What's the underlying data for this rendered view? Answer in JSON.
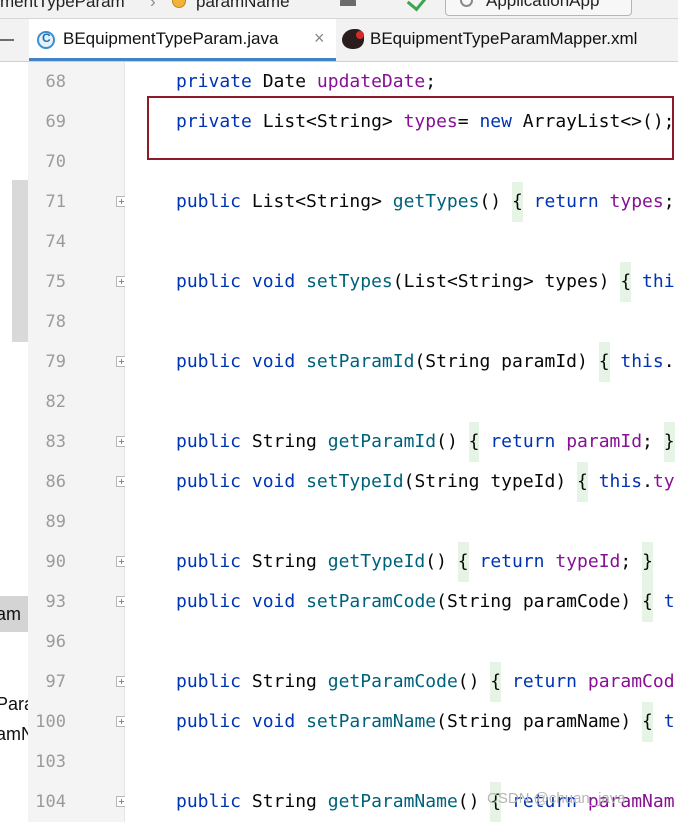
{
  "topbar": {
    "crumb_left": "mentTypeParam",
    "crumb_right": "paramName",
    "sep": "›",
    "run_config": "ApplicationApp"
  },
  "tabs": [
    {
      "label": "BEquipmentTypeParam.java",
      "close": "×",
      "icon": "java-class-icon"
    },
    {
      "label": "BEquipmentTypeParamMapper.xml",
      "icon": "mybatis-bird-icon"
    }
  ],
  "left_panel": {
    "fragments": [
      "am",
      "Para",
      "amN"
    ]
  },
  "editor": {
    "lines": [
      {
        "num": "68",
        "fold": false,
        "parts": [
          [
            "kw",
            "private"
          ],
          [
            "t",
            " Date "
          ],
          [
            "fld",
            "updateDate"
          ],
          [
            "t",
            ";"
          ]
        ]
      },
      {
        "num": "69",
        "fold": false,
        "parts": [
          [
            "kw",
            "private"
          ],
          [
            "t",
            " List<String> "
          ],
          [
            "fld",
            "types"
          ],
          [
            "t",
            "= "
          ],
          [
            "kw",
            "new"
          ],
          [
            "t",
            " ArrayList<>();"
          ]
        ]
      },
      {
        "num": "70",
        "fold": false,
        "parts": []
      },
      {
        "num": "71",
        "fold": true,
        "parts": [
          [
            "kw",
            "public"
          ],
          [
            "t",
            " List<String> "
          ],
          [
            "fn",
            "getTypes"
          ],
          [
            "t",
            "() "
          ],
          [
            "br",
            "{"
          ],
          [
            "t",
            " "
          ],
          [
            "kw",
            "return"
          ],
          [
            "t",
            " "
          ],
          [
            "fld",
            "types"
          ],
          [
            "t",
            ";"
          ]
        ]
      },
      {
        "num": "74",
        "fold": false,
        "parts": []
      },
      {
        "num": "75",
        "fold": true,
        "parts": [
          [
            "kw",
            "public"
          ],
          [
            "t",
            " "
          ],
          [
            "kw",
            "void"
          ],
          [
            "t",
            " "
          ],
          [
            "fn",
            "setTypes"
          ],
          [
            "t",
            "(List<String> types) "
          ],
          [
            "br",
            "{"
          ],
          [
            "t",
            " "
          ],
          [
            "kw",
            "thi"
          ]
        ]
      },
      {
        "num": "78",
        "fold": false,
        "parts": []
      },
      {
        "num": "79",
        "fold": true,
        "parts": [
          [
            "kw",
            "public"
          ],
          [
            "t",
            " "
          ],
          [
            "kw",
            "void"
          ],
          [
            "t",
            " "
          ],
          [
            "fn",
            "setParamId"
          ],
          [
            "t",
            "(String paramId) "
          ],
          [
            "br",
            "{"
          ],
          [
            "t",
            " "
          ],
          [
            "kw",
            "this"
          ],
          [
            "t",
            "."
          ]
        ]
      },
      {
        "num": "82",
        "fold": false,
        "parts": []
      },
      {
        "num": "83",
        "fold": true,
        "parts": [
          [
            "kw",
            "public"
          ],
          [
            "t",
            " String "
          ],
          [
            "fn",
            "getParamId"
          ],
          [
            "t",
            "() "
          ],
          [
            "br",
            "{"
          ],
          [
            "t",
            " "
          ],
          [
            "kw",
            "return"
          ],
          [
            "t",
            " "
          ],
          [
            "fld",
            "paramId"
          ],
          [
            "t",
            "; "
          ],
          [
            "br",
            "}"
          ]
        ]
      },
      {
        "num": "86",
        "fold": true,
        "parts": [
          [
            "kw",
            "public"
          ],
          [
            "t",
            " "
          ],
          [
            "kw",
            "void"
          ],
          [
            "t",
            " "
          ],
          [
            "fn",
            "setTypeId"
          ],
          [
            "t",
            "(String typeId) "
          ],
          [
            "br",
            "{"
          ],
          [
            "t",
            " "
          ],
          [
            "kw",
            "this"
          ],
          [
            "t",
            "."
          ],
          [
            "fld",
            "ty"
          ]
        ]
      },
      {
        "num": "89",
        "fold": false,
        "parts": []
      },
      {
        "num": "90",
        "fold": true,
        "parts": [
          [
            "kw",
            "public"
          ],
          [
            "t",
            " String "
          ],
          [
            "fn",
            "getTypeId"
          ],
          [
            "t",
            "() "
          ],
          [
            "br",
            "{"
          ],
          [
            "t",
            " "
          ],
          [
            "kw",
            "return"
          ],
          [
            "t",
            " "
          ],
          [
            "fld",
            "typeId"
          ],
          [
            "t",
            "; "
          ],
          [
            "br",
            "}"
          ]
        ]
      },
      {
        "num": "93",
        "fold": true,
        "parts": [
          [
            "kw",
            "public"
          ],
          [
            "t",
            " "
          ],
          [
            "kw",
            "void"
          ],
          [
            "t",
            " "
          ],
          [
            "fn",
            "setParamCode"
          ],
          [
            "t",
            "(String paramCode) "
          ],
          [
            "br",
            "{"
          ],
          [
            "t",
            " "
          ],
          [
            "kw",
            "t"
          ]
        ]
      },
      {
        "num": "96",
        "fold": false,
        "parts": []
      },
      {
        "num": "97",
        "fold": true,
        "parts": [
          [
            "kw",
            "public"
          ],
          [
            "t",
            " String "
          ],
          [
            "fn",
            "getParamCode"
          ],
          [
            "t",
            "() "
          ],
          [
            "br",
            "{"
          ],
          [
            "t",
            " "
          ],
          [
            "kw",
            "return"
          ],
          [
            "t",
            " "
          ],
          [
            "fld",
            "paramCod"
          ]
        ]
      },
      {
        "num": "100",
        "fold": true,
        "parts": [
          [
            "kw",
            "public"
          ],
          [
            "t",
            " "
          ],
          [
            "kw",
            "void"
          ],
          [
            "t",
            " "
          ],
          [
            "fn",
            "setParamName"
          ],
          [
            "t",
            "(String paramName) "
          ],
          [
            "br",
            "{"
          ],
          [
            "t",
            " "
          ],
          [
            "kw",
            "t"
          ]
        ]
      },
      {
        "num": "103",
        "fold": false,
        "parts": []
      },
      {
        "num": "104",
        "fold": true,
        "parts": [
          [
            "kw",
            "public"
          ],
          [
            "t",
            " String "
          ],
          [
            "fn",
            "getParamName"
          ],
          [
            "t",
            "() "
          ],
          [
            "br",
            "{"
          ],
          [
            "t",
            " "
          ],
          [
            "kw",
            "return"
          ],
          [
            "t",
            " "
          ],
          [
            "fld",
            "paramNam"
          ]
        ]
      }
    ]
  },
  "watermark": "CSDN @chuan_java",
  "colors": {
    "keyword": "#0033b3",
    "method": "#00627a",
    "field": "#871094",
    "selection_border": "#8b1a2b",
    "tab_underline": "#4083c9"
  }
}
